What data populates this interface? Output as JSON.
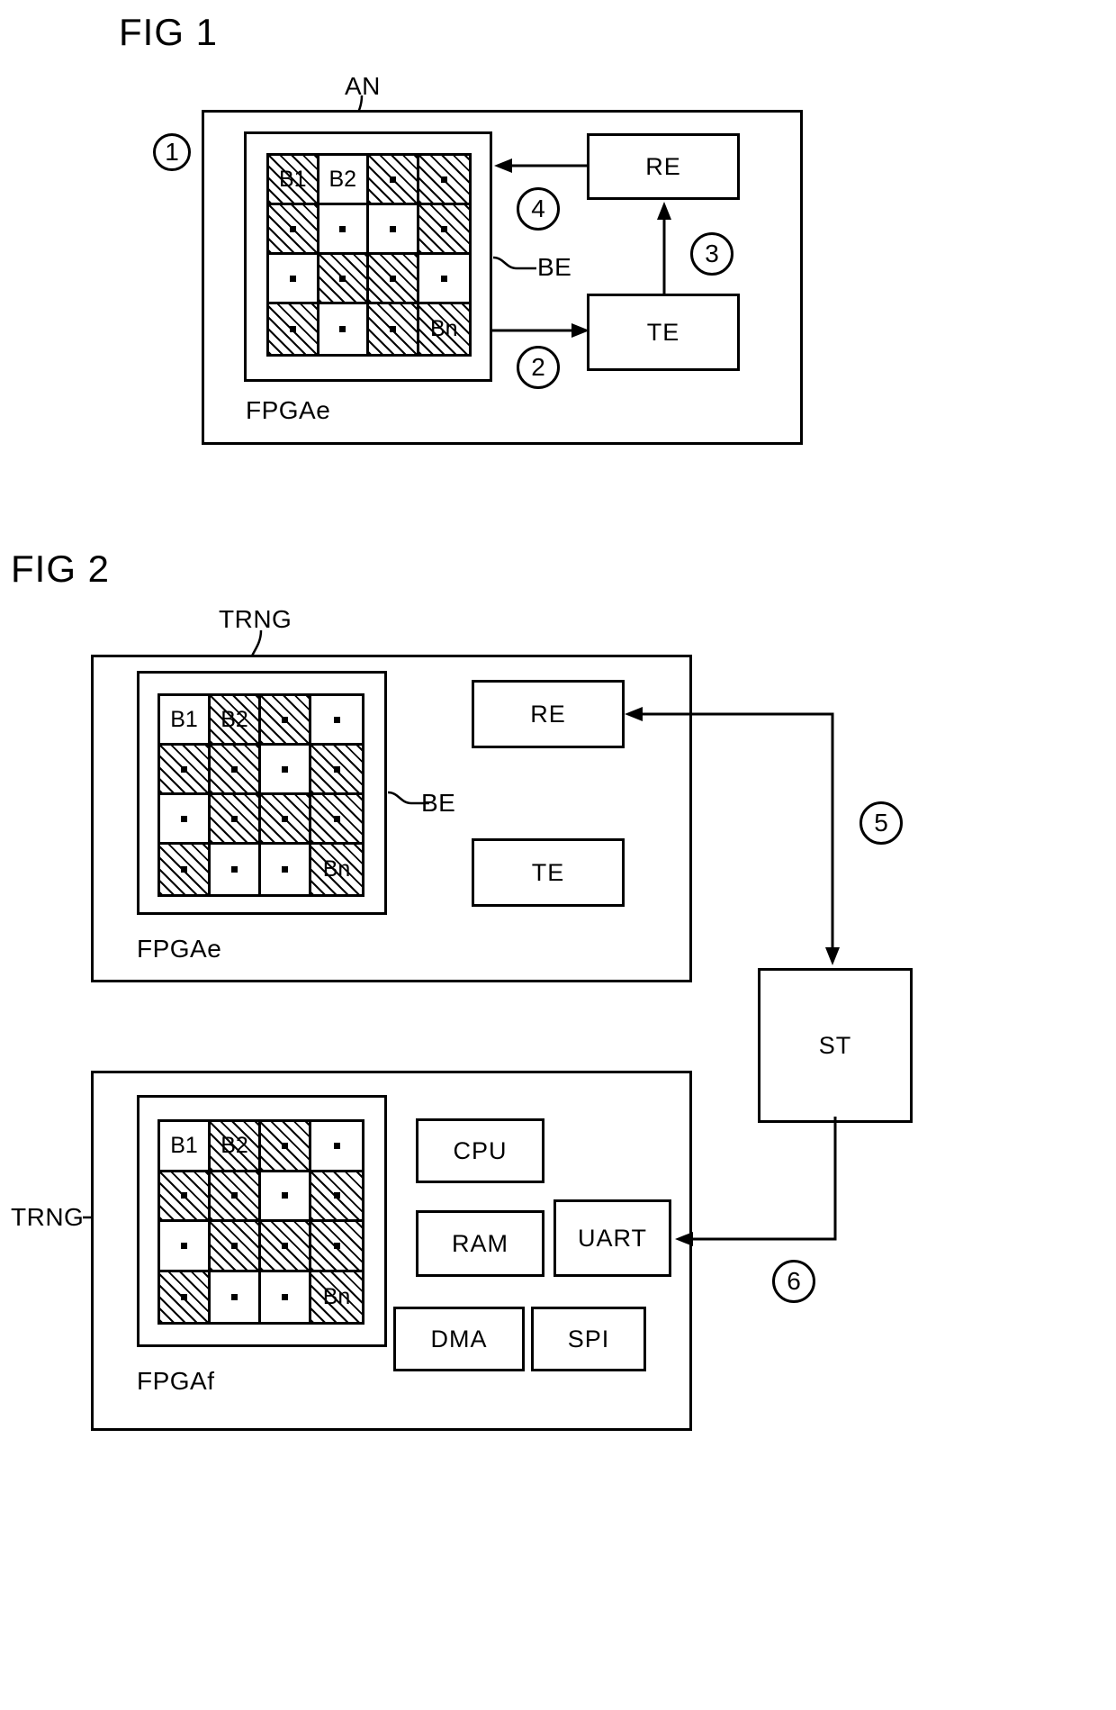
{
  "figures": {
    "fig1": {
      "title": "FIG 1",
      "chip_label": "FPGAe",
      "an_label": "AN",
      "be_label": "BE",
      "grid": {
        "b1": "B1",
        "b2": "B2",
        "bn": "Bn",
        "hatched": [
          [
            true,
            false,
            true,
            true
          ],
          [
            true,
            false,
            false,
            true
          ],
          [
            false,
            true,
            true,
            false
          ],
          [
            true,
            false,
            true,
            true
          ]
        ]
      },
      "blocks": {
        "re": "RE",
        "te": "TE"
      },
      "markers": {
        "one": "1",
        "two": "2",
        "three": "3",
        "four": "4"
      }
    },
    "fig2": {
      "title": "FIG 2",
      "trng_label_top": "TRNG",
      "trng_label_bottom": "TRNG",
      "be_label": "BE",
      "chip_label_top": "FPGAe",
      "chip_label_bottom": "FPGAf",
      "grid": {
        "b1": "B1",
        "b2": "B2",
        "bn": "Bn",
        "hatched": [
          [
            false,
            true,
            true,
            false
          ],
          [
            true,
            true,
            false,
            true
          ],
          [
            false,
            true,
            true,
            true
          ],
          [
            true,
            false,
            false,
            true
          ]
        ]
      },
      "blocks": {
        "re": "RE",
        "te": "TE",
        "st": "ST",
        "cpu": "CPU",
        "ram": "RAM",
        "uart": "UART",
        "dma": "DMA",
        "spi": "SPI"
      },
      "markers": {
        "five": "5",
        "six": "6"
      }
    }
  }
}
